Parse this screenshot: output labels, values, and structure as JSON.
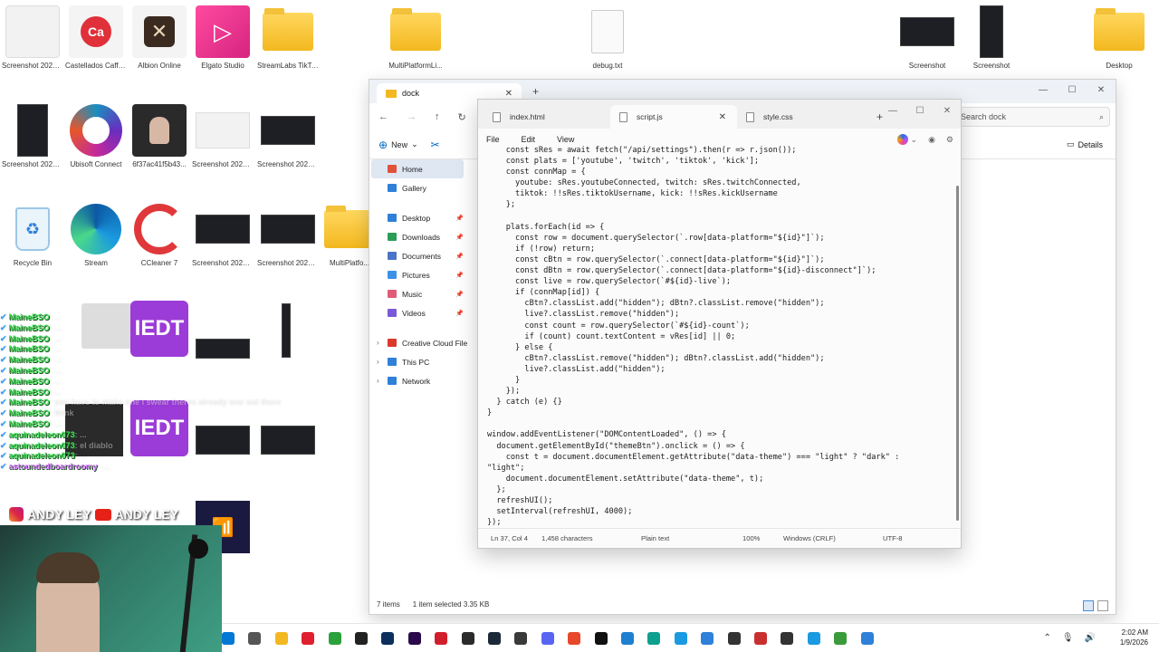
{
  "desktop": {
    "icons": [
      {
        "label": "Screenshot 2026-01-...",
        "kind": "shot-light"
      },
      {
        "label": "Castellados Caffeinated",
        "kind": "app"
      },
      {
        "label": "Albion Online",
        "kind": "app"
      },
      {
        "label": "Elgato Studio",
        "kind": "app"
      },
      {
        "label": "StreamLabs TikTok...",
        "kind": "folder"
      },
      {
        "label": "MultiPlatformLi...",
        "kind": "folder"
      },
      {
        "label": "debug.txt",
        "kind": "file"
      },
      {
        "label": "Screenshot",
        "kind": "shot"
      },
      {
        "label": "Screenshot",
        "kind": "shot"
      },
      {
        "label": "Desktop",
        "kind": "folder"
      },
      {
        "label": "Screenshot 2026-01-...",
        "kind": "shot"
      },
      {
        "label": "Ubisoft Connect",
        "kind": "app"
      },
      {
        "label": "6f37ac41f5b43...",
        "kind": "photo"
      },
      {
        "label": "Screenshot 2026-01-...",
        "kind": "shot-light"
      },
      {
        "label": "Screenshot 2026-01-...",
        "kind": "shot"
      },
      {
        "label": "Recycle Bin",
        "kind": "app"
      },
      {
        "label": "Stream",
        "kind": "app"
      },
      {
        "label": "CCleaner 7",
        "kind": "app"
      },
      {
        "label": "Screenshot 2026-01-...",
        "kind": "shot"
      },
      {
        "label": "Screenshot 2026-01-...",
        "kind": "shot"
      },
      {
        "label": "MultiPlatfo...",
        "kind": "folder"
      }
    ]
  },
  "chat": [
    {
      "user": "MaineBSO",
      "text": "...",
      "color": "#44e05a"
    },
    {
      "user": "MaineBSO",
      "text": "...",
      "color": "#44e05a"
    },
    {
      "user": "MaineBSO",
      "text": "...",
      "color": "#44e05a"
    },
    {
      "user": "MaineBSO",
      "text": "...",
      "color": "#44e05a"
    },
    {
      "user": "MaineBSO",
      "text": "...",
      "color": "#44e05a"
    },
    {
      "user": "MaineBSO",
      "text": "...",
      "color": "#44e05a"
    },
    {
      "user": "MaineBSO",
      "text": "...",
      "color": "#44e05a"
    },
    {
      "user": "MaineBSO",
      "text": "...",
      "color": "#44e05a"
    },
    {
      "user": "MaineBSO",
      "text": "you have to make one i swear theres already one out there",
      "color": "#44e05a"
    },
    {
      "user": "MaineBSO",
      "text": "think",
      "color": "#44e05a"
    },
    {
      "user": "MaineBSO",
      "text": "...",
      "color": "#44e05a"
    },
    {
      "user": "aquinadeleon073",
      "text": "...",
      "color": "#44e05a"
    },
    {
      "user": "aquinadeleon073",
      "text": "el diablo",
      "color": "#44e05a"
    },
    {
      "user": "aquinadeleon073",
      "text": "...",
      "color": "#44e05a"
    },
    {
      "user": "astoundedboardroomy",
      "text": "...",
      "color": "#d77cff"
    }
  ],
  "banner": {
    "text1": "ANDY LEY",
    "text2": "ANDY LEY"
  },
  "explorer": {
    "tab_title": "dock",
    "search_placeholder": "Search dock",
    "new_label": "New",
    "details_label": "Details",
    "sidebar": [
      {
        "label": "Home",
        "icon": "home-icon",
        "color": "#e0533a",
        "active": true
      },
      {
        "label": "Gallery",
        "icon": "gallery-icon",
        "color": "#2f80d8",
        "active": false
      }
    ],
    "quick_access": [
      {
        "label": "Desktop",
        "color": "#2f80d8"
      },
      {
        "label": "Downloads",
        "color": "#2a9d57"
      },
      {
        "label": "Documents",
        "color": "#4a74c8"
      },
      {
        "label": "Pictures",
        "color": "#3c91e6"
      },
      {
        "label": "Music",
        "color": "#e05a7a"
      },
      {
        "label": "Videos",
        "color": "#7a5ad8"
      }
    ],
    "tree": [
      {
        "label": "Creative Cloud File",
        "color": "#da3a2a"
      },
      {
        "label": "This PC",
        "color": "#2f80d8"
      },
      {
        "label": "Network",
        "color": "#2f80d8"
      }
    ],
    "status_items": "7 items",
    "status_selected": "1 item selected  3.35 KB"
  },
  "notepad": {
    "tabs": [
      {
        "label": "index.html",
        "active": false
      },
      {
        "label": "script.js",
        "active": true
      },
      {
        "label": "style.css",
        "active": false
      }
    ],
    "menu": [
      "File",
      "Edit",
      "View"
    ],
    "code": [
      "    const sRes = await fetch(\"/api/settings\").then(r => r.json());",
      "    const plats = ['youtube', 'twitch', 'tiktok', 'kick'];",
      "    const connMap = {",
      "      youtube: sRes.youtubeConnected, twitch: sRes.twitchConnected,",
      "      tiktok: !!sRes.tiktokUsername, kick: !!sRes.kickUsername",
      "    };",
      "",
      "    plats.forEach(id => {",
      "      const row = document.querySelector(`.row[data-platform=\"${id}\"]`);",
      "      if (!row) return;",
      "      const cBtn = row.querySelector(`.connect[data-platform=\"${id}\"]`);",
      "      const dBtn = row.querySelector(`.connect[data-platform=\"${id}-disconnect\"]`);",
      "      const live = row.querySelector(`#${id}-live`);",
      "      if (connMap[id]) {",
      "        cBtn?.classList.add(\"hidden\"); dBtn?.classList.remove(\"hidden\");",
      "        live?.classList.remove(\"hidden\");",
      "        const count = row.querySelector(`#${id}-count`);",
      "        if (count) count.textContent = vRes[id] || 0;",
      "      } else {",
      "        cBtn?.classList.remove(\"hidden\"); dBtn?.classList.add(\"hidden\");",
      "        live?.classList.add(\"hidden\");",
      "      }",
      "    });",
      "  } catch (e) {}",
      "}",
      "",
      "window.addEventListener(\"DOMContentLoaded\", () => {",
      "  document.getElementById(\"themeBtn\").onclick = () => {",
      "    const t = document.documentElement.getAttribute(\"data-theme\") === \"light\" ? \"dark\" :",
      "\"light\";",
      "    document.documentElement.setAttribute(\"data-theme\", t);",
      "  };",
      "  refreshUI();",
      "  setInterval(refreshUI, 4000);",
      "});"
    ],
    "status": {
      "position": "Ln 37, Col 4",
      "chars": "1,458 characters",
      "format": "Plain text",
      "zoom": "100%",
      "line_ending": "Windows (CRLF)",
      "encoding": "UTF-8"
    }
  },
  "taskbar": {
    "time": "2:02 AM",
    "date": "1/9/2026",
    "apps": [
      {
        "name": "start-icon",
        "color": "#0078d4"
      },
      {
        "name": "search-icon",
        "color": "#555555"
      },
      {
        "name": "file-explorer-icon",
        "color": "#f3b81f"
      },
      {
        "name": "opera-icon",
        "color": "#e0202e"
      },
      {
        "name": "xbox-icon",
        "color": "#2aa13a"
      },
      {
        "name": "capcut-icon",
        "color": "#222222"
      },
      {
        "name": "photoshop-icon",
        "color": "#0b2f5a"
      },
      {
        "name": "premiere-icon",
        "color": "#2a0a4a"
      },
      {
        "name": "obs-icon",
        "color": "#d01f2b"
      },
      {
        "name": "epic-icon",
        "color": "#2b2b2b"
      },
      {
        "name": "steam-icon",
        "color": "#1b2838"
      },
      {
        "name": "obs-studio-icon",
        "color": "#3a3a3a"
      },
      {
        "name": "discord-icon",
        "color": "#5865f2"
      },
      {
        "name": "chrome-icon",
        "color": "#e7482b"
      },
      {
        "name": "tiktok-icon",
        "color": "#111111"
      },
      {
        "name": "vscode-icon",
        "color": "#1f7fd1"
      },
      {
        "name": "streamlabs-icon",
        "color": "#0ea08e"
      },
      {
        "name": "edge-icon",
        "color": "#1a9ae0"
      },
      {
        "name": "notepad-icon",
        "color": "#2f80d8"
      },
      {
        "name": "terminal-icon",
        "color": "#333333"
      },
      {
        "name": "app-icon",
        "color": "#c83030"
      },
      {
        "name": "app2-icon",
        "color": "#333333"
      },
      {
        "name": "edge2-icon",
        "color": "#1a9ae0"
      },
      {
        "name": "notepadplus-icon",
        "color": "#3a9b3a"
      },
      {
        "name": "snip-icon",
        "color": "#2f80d8"
      }
    ]
  }
}
